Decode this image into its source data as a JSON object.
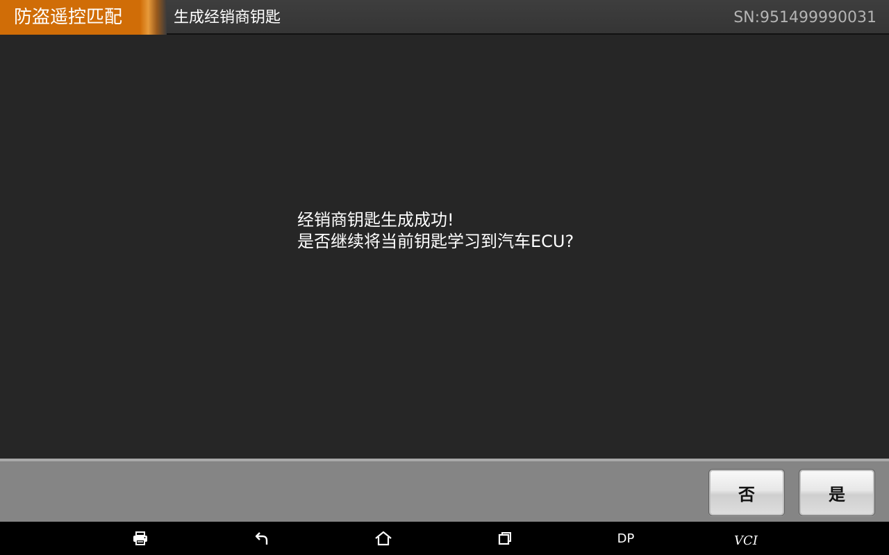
{
  "header": {
    "module_title": "防盗遥控匹配",
    "sub_title": "生成经销商钥匙",
    "serial": "SN:951499990031"
  },
  "message": {
    "line1": "经销商钥匙生成成功!",
    "line2": "是否继续将当前钥匙学习到汽车ECU?"
  },
  "actions": {
    "no_label": "否",
    "yes_label": "是"
  },
  "navbar": {
    "print_icon": "printer-icon",
    "back_icon": "back-icon",
    "home_icon": "home-icon",
    "recent_icon": "recent-apps-icon",
    "dp_label": "DP",
    "vci_label": "VCI"
  },
  "colors": {
    "accent_orange": "#d06d07",
    "background": "#262626",
    "action_bar": "#858585",
    "serial_text": "#b4b4b4"
  }
}
